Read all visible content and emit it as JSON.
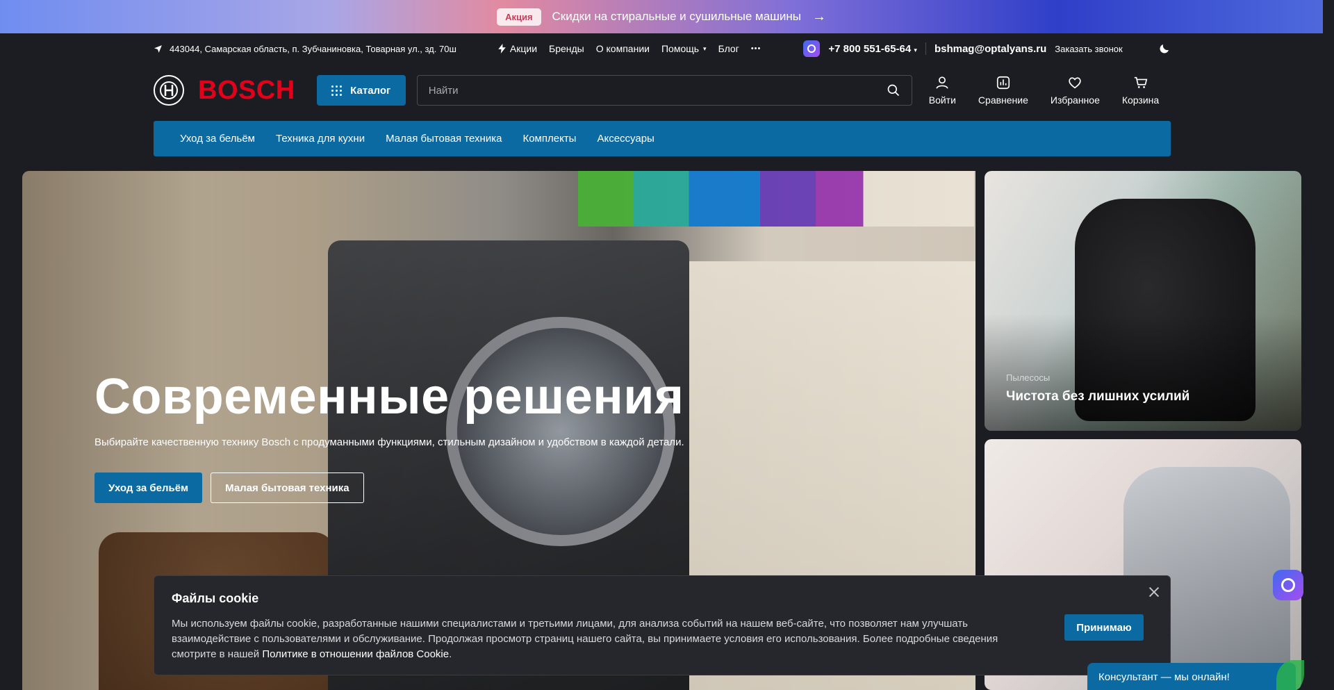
{
  "promo": {
    "badge": "Акция",
    "text": "Скидки на стиральные и сушильные машины",
    "arrow": "→"
  },
  "util": {
    "address": "443044, Самарская область, п. Зубчаниновка, Товарная ул., зд. 70ш",
    "links": [
      "Акции",
      "Бренды",
      "О компании",
      "Помощь",
      "Блог"
    ],
    "more": "•••",
    "phone": "+7 800 551-65-64",
    "email": "bshmag@optalyans.ru",
    "callback": "Заказать звонок"
  },
  "header": {
    "logo": "BOSCH",
    "catalog": "Каталог",
    "search_placeholder": "Найти",
    "icons": [
      "Войти",
      "Сравнение",
      "Избранное",
      "Корзина"
    ]
  },
  "nav": [
    "Уход за бельём",
    "Техника для кухни",
    "Малая бытовая техника",
    "Комплекты",
    "Аксессуары"
  ],
  "hero": {
    "title": "Современные решения",
    "subtitle": "Выбирайте качественную технику Bosch с продуманными функциями, стильным дизайном и удобством в каждой детали.",
    "btn_primary": "Уход за бельём",
    "btn_secondary": "Малая бытовая техника"
  },
  "card1": {
    "category": "Пылесосы",
    "title": "Чистота без лишних усилий"
  },
  "cookie": {
    "title": "Файлы cookie",
    "text": "Мы используем файлы cookie, разработанные нашими специалистами и третьими лицами, для анализа событий на нашем веб-сайте, что позволяет нам улучшать взаимодействие с пользователями и обслуживание. Продолжая просмотр страниц нашего сайта, вы принимаете условия его использования. Более подробные сведения смотрите в нашей ",
    "link": "Политике в отношении файлов Cookie",
    "period": ".",
    "accept": "Принимаю"
  },
  "consultant": "Консультант — мы онлайн!",
  "colors": {
    "accent": "#0b6aa2",
    "brand": "#e2001a",
    "background": "#1c1d22"
  }
}
